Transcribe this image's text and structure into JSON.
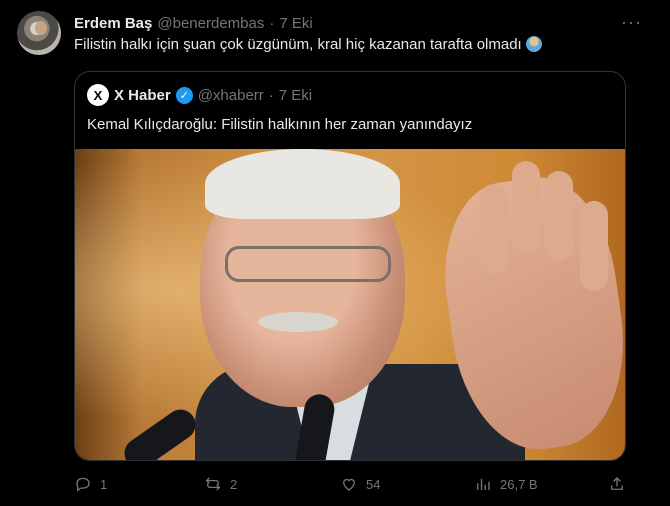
{
  "tweet": {
    "author_name": "Erdem Baş",
    "handle": "@benerdembas",
    "separator": "·",
    "time": "7 Eki",
    "more_label": "···",
    "text": "Filistin halkı için şuan çok üzgünüm, kral hiç kazanan tarafta olmadı"
  },
  "quote": {
    "logo_label": "X",
    "author_name": "X Haber",
    "handle": "@xhaberr",
    "separator": "·",
    "time": "7 Eki",
    "text": "Kemal Kılıçdaroğlu: Filistin halkının her zaman yanındayız"
  },
  "actions": {
    "replies": "1",
    "reposts": "2",
    "likes": "54",
    "views": "26,7 B"
  },
  "colors": {
    "background": "#000000",
    "text": "#e7e9ea",
    "muted": "#71767b",
    "verified": "#1d9bf0"
  }
}
